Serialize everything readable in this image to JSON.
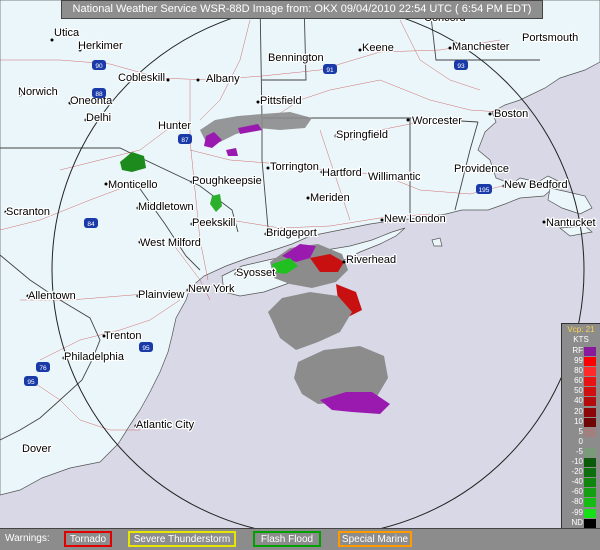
{
  "title": "National Weather Service WSR-88D Image from: OKX 09/04/2010  22:54 UTC ( 6:54 PM EDT)",
  "cities": [
    {
      "name": "Utica"
    },
    {
      "name": "Herkimer"
    },
    {
      "name": "Concord"
    },
    {
      "name": "Cobleskill"
    },
    {
      "name": "Albany"
    },
    {
      "name": "Bennington"
    },
    {
      "name": "Keene"
    },
    {
      "name": "Manchester"
    },
    {
      "name": "Portsmouth"
    },
    {
      "name": "Norwich"
    },
    {
      "name": "Oneonta"
    },
    {
      "name": "Delhi"
    },
    {
      "name": "Pittsfield"
    },
    {
      "name": "Worcester"
    },
    {
      "name": "Boston"
    },
    {
      "name": "Hunter"
    },
    {
      "name": "Springfield"
    },
    {
      "name": "Monticello"
    },
    {
      "name": "Poughkeepsie"
    },
    {
      "name": "Torrington"
    },
    {
      "name": "Hartford"
    },
    {
      "name": "Willimantic"
    },
    {
      "name": "Providence"
    },
    {
      "name": "New Bedford"
    },
    {
      "name": "Scranton"
    },
    {
      "name": "Middletown"
    },
    {
      "name": "Peekskill"
    },
    {
      "name": "Meriden"
    },
    {
      "name": "New London"
    },
    {
      "name": "Nantucket"
    },
    {
      "name": "West Milford"
    },
    {
      "name": "Bridgeport"
    },
    {
      "name": "Riverhead"
    },
    {
      "name": "Syosset"
    },
    {
      "name": "Allentown"
    },
    {
      "name": "Plainview"
    },
    {
      "name": "New York"
    },
    {
      "name": "Trenton"
    },
    {
      "name": "Philadelphia"
    },
    {
      "name": "Atlantic City"
    },
    {
      "name": "Dover"
    }
  ],
  "shields": [
    {
      "label": "90"
    },
    {
      "label": "91"
    },
    {
      "label": "93"
    },
    {
      "label": "87"
    },
    {
      "label": "88"
    },
    {
      "label": "84"
    },
    {
      "label": "95"
    },
    {
      "label": "195"
    },
    {
      "label": "76"
    },
    {
      "label": "95"
    },
    {
      "label": "295"
    }
  ],
  "legend": {
    "vcp": "Vcp: 21",
    "units": "KTS",
    "entries": [
      {
        "label": "RF",
        "color": "#8a1a9c"
      },
      {
        "label": "99",
        "color": "#ff0000"
      },
      {
        "label": "80",
        "color": "#ff2a2a"
      },
      {
        "label": "60",
        "color": "#e81414"
      },
      {
        "label": "50",
        "color": "#d01010"
      },
      {
        "label": "40",
        "color": "#b40c0c"
      },
      {
        "label": "20",
        "color": "#8c0808"
      },
      {
        "label": "10",
        "color": "#6e0606"
      },
      {
        "label": "5",
        "color": "#a28080"
      },
      {
        "label": "0",
        "color": "#8c8c8c"
      },
      {
        "label": "-5",
        "color": "#7a9a7a"
      },
      {
        "label": "-10",
        "color": "#0a5a0a"
      },
      {
        "label": "-20",
        "color": "#0c6e0c"
      },
      {
        "label": "-40",
        "color": "#0e860e"
      },
      {
        "label": "-60",
        "color": "#12a012"
      },
      {
        "label": "-80",
        "color": "#14bc14"
      },
      {
        "label": "-99",
        "color": "#18e018"
      },
      {
        "label": "ND",
        "color": "#000000"
      }
    ]
  },
  "warnings": {
    "label": "Warnings:",
    "items": [
      {
        "label": "Tornado",
        "color": "#e00000"
      },
      {
        "label": "Severe Thunderstorm",
        "color": "#e6e600"
      },
      {
        "label": "Flash Flood",
        "color": "#00a000"
      },
      {
        "label": "Special Marine",
        "color": "#ff9a00"
      }
    ]
  }
}
